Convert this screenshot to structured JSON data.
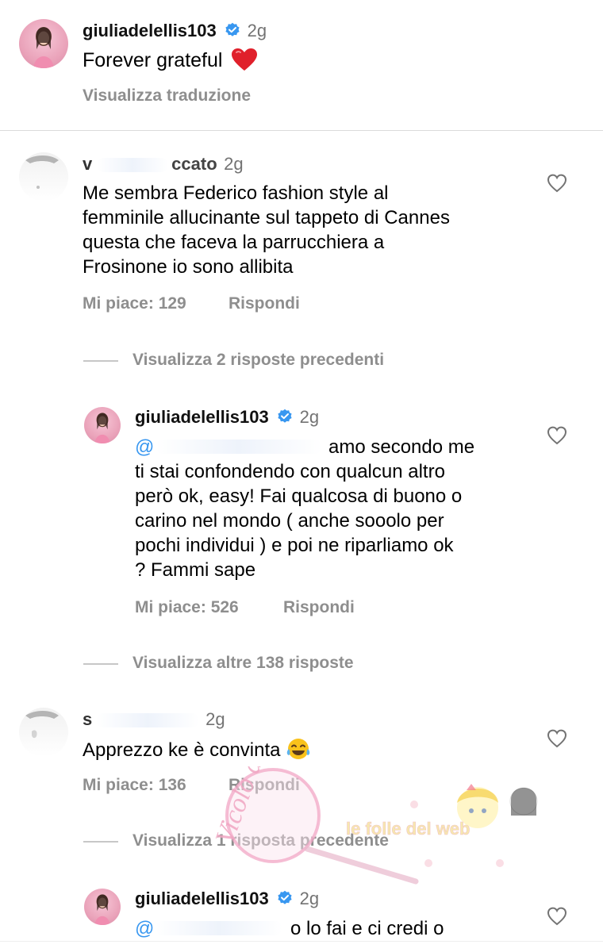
{
  "post_caption": {
    "username": "giuliadelellis103",
    "time": "2g",
    "text": "Forever grateful",
    "emoji": "❤️",
    "translate": "Visualizza traduzione"
  },
  "comments": [
    {
      "username_visible": "ccato",
      "time": "2g",
      "text_lines": [
        "Me sembra Federico fashion style al",
        "femminile allucinante sul tappeto di Cannes",
        "questa che faceva la parrucchiera a",
        "Frosinone io sono allibita"
      ],
      "likes": "Mi piace: 129",
      "reply": "Rispondi",
      "view_replies": "Visualizza 2 risposte precedenti",
      "reply_item": {
        "username": "giuliadelellis103",
        "time": "2g",
        "mention_tail": "amo secondo me",
        "text_lines": [
          "ti stai confondendo con qualcun altro",
          "però ok, easy! Fai qualcosa di buono o",
          "carino nel mondo ( anche sooolo per",
          "pochi individui ) e poi ne riparliamo ok",
          "? Fammi sape"
        ],
        "likes": "Mi piace: 526",
        "reply": "Rispondi"
      },
      "more_replies": "Visualizza altre 138 risposte"
    },
    {
      "username_visible": "s",
      "time": "2g",
      "text": "Apprezzo ke è convinta",
      "emoji": "😂",
      "likes": "Mi piace: 136",
      "reply": "Rispondi",
      "view_replies": "Visualizza 1 risposta precedente",
      "reply_item": {
        "username": "giuliadelellis103",
        "time": "2g",
        "text_partial": "o lo fai e ci credi o"
      }
    }
  ],
  "watermark": {
    "left": "Vicolo delle News",
    "right": "le folle del web"
  },
  "colors": {
    "verified": "#3897f0",
    "muted": "#8e8e8e",
    "heart": "#e0202b"
  }
}
